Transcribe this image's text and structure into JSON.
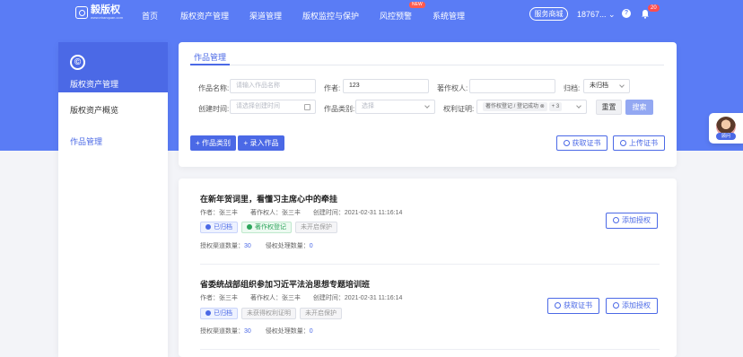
{
  "brand": {
    "name": "毅版权",
    "sub": "www.ebanquan.com"
  },
  "nav": {
    "items": [
      "首页",
      "版权资产管理",
      "渠道管理",
      "版权监控与保护",
      "风控预警",
      "系统管理"
    ],
    "new_badge": "NEW"
  },
  "header": {
    "mall": "服务商城",
    "phone": "18767...",
    "bell_count": "20",
    "help": "?"
  },
  "sidebar": {
    "title": "版权资产管理",
    "icon": "©",
    "items": [
      "版权资产概览",
      "作品管理"
    ]
  },
  "search": {
    "tab": "作品管理",
    "work_name_label": "作品名称:",
    "work_name_placeholder": "请输入作品名称",
    "author_label": "作者:",
    "author_value": "123",
    "owner_label": "著作权人:",
    "archive_label": "归档:",
    "archive_value": "未归档",
    "created_label": "创建时间:",
    "created_placeholder": "请选择创建时间",
    "type_label": "作品类别:",
    "type_placeholder": "选择",
    "proof_label": "权利证明:",
    "proof_tag": "著作权登记 / 登记成功",
    "proof_more": "+ 3",
    "reset": "重置",
    "search": "搜索",
    "add_category": "+ 作品类别",
    "import_work": "+ 录入作品",
    "get_cert": "获取证书",
    "upload_cert": "上传证书"
  },
  "works": [
    {
      "title": "在新年贺词里，看懂习主席心中的牵挂",
      "author": "作者：张三丰",
      "owner": "著作权人：张三丰",
      "created": "创建时间：2021-02-31  11:16:14",
      "tags": [
        {
          "text": "已归档",
          "style": "blue"
        },
        {
          "text": "著作权登记",
          "style": "green"
        },
        {
          "text": "未开启保护",
          "style": "grey"
        }
      ],
      "channel_label": "授权渠道数量：",
      "channel_count": "30",
      "infringe_label": "侵权处理数量：",
      "infringe_count": "0",
      "add_auth": "添加授权"
    },
    {
      "title": "省委统战部组织参加习近平法治思想专题培训班",
      "author": "作者：张三丰",
      "owner": "著作权人：张三丰",
      "created": "创建时间：2021-02-31  11:16:14",
      "tags": [
        {
          "text": "已归档",
          "style": "blue"
        },
        {
          "text": "未获得权利证明",
          "style": "grey"
        },
        {
          "text": "未开启保护",
          "style": "grey"
        }
      ],
      "channel_label": "授权渠道数量：",
      "channel_count": "30",
      "infringe_label": "侵权处理数量：",
      "infringe_count": "0",
      "get_cert": "获取证书",
      "add_auth": "添加授权"
    }
  ],
  "service": {
    "label": "顾问"
  }
}
